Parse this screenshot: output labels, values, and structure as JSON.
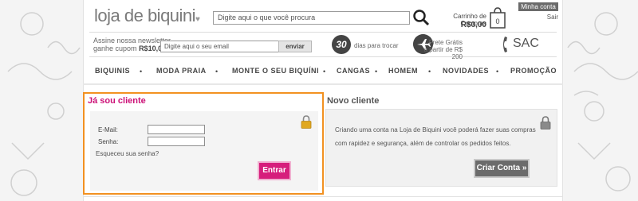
{
  "header": {
    "logo": "loja de biquini",
    "search_placeholder": "Digite aqui o que você procura",
    "cart_title": "Carrinho de Compras",
    "cart_value": "R$0,00",
    "cart_count": "0",
    "account_tab": "Minha conta",
    "logout": "Sair"
  },
  "promo": {
    "newsletter_line1": "Assine nossa newsletter",
    "newsletter_line2_prefix": "ganhe cupom",
    "newsletter_line2_value": "R$10,00",
    "email_placeholder": "Digite aqui o seu email",
    "send_button": "enviar",
    "badge_number": "30",
    "days_text": "dias para trocar",
    "shipping_line1": "Frete Grátis",
    "shipping_line2": "a partir de R$ 200",
    "sac": "SAC"
  },
  "nav": {
    "items": [
      "BIQUINIS",
      "MODA PRAIA",
      "MONTE O SEU BIQUÍNI",
      "CANGAS",
      "HOMEM",
      "NOVIDADES",
      "PROMOÇÃO"
    ]
  },
  "login": {
    "title": "Já sou cliente",
    "email_label": "E-Mail:",
    "password_label": "Senha:",
    "forgot": "Esqueceu sua senha?",
    "submit": "Entrar"
  },
  "new_client": {
    "title": "Novo cliente",
    "text_line1": "Criando uma conta na Loja de Biquini você poderá fazer suas compras",
    "text_line2": "com rapidez e segurança, além de controlar os pedidos feitos.",
    "button": "Criar Conta »"
  },
  "colors": {
    "accent": "#d61e7c",
    "title_pink": "#cc1177",
    "login_border": "#f29121",
    "lock_gold": "#e0a820"
  }
}
